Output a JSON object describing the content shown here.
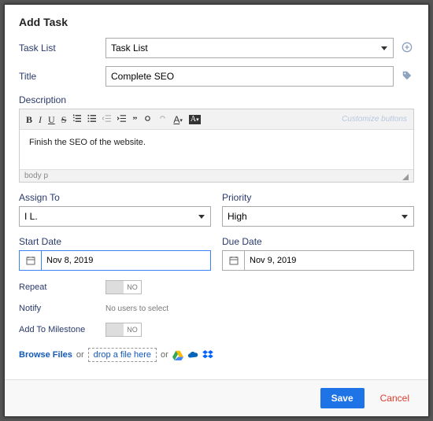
{
  "title": "Add Task",
  "labels": {
    "task_list": "Task List",
    "title": "Title",
    "description": "Description",
    "assign_to": "Assign To",
    "priority": "Priority",
    "start_date": "Start Date",
    "due_date": "Due Date",
    "repeat": "Repeat",
    "notify": "Notify",
    "milestone": "Add To Milestone"
  },
  "fields": {
    "task_list_value": "Task List",
    "title_value": "Complete SEO",
    "description_value": "Finish the SEO of the website.",
    "assign_to_value": "I L.",
    "priority_value": "High",
    "start_date_value": "Nov 8, 2019",
    "due_date_value": "Nov 9, 2019",
    "repeat_state": "NO",
    "notify_text": "No users to select",
    "milestone_state": "NO"
  },
  "editor": {
    "breadcrumb": "body   p",
    "customize": "Customize buttons"
  },
  "files": {
    "browse": "Browse Files",
    "or1": "or",
    "drop": "drop a file here",
    "or2": "or"
  },
  "footer": {
    "save": "Save",
    "cancel": "Cancel"
  }
}
